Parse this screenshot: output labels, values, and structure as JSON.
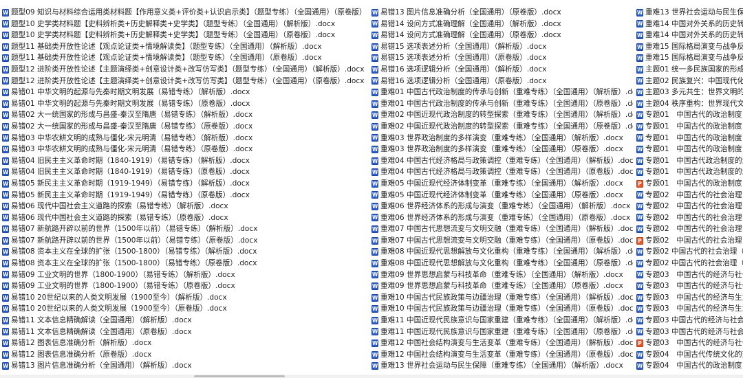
{
  "columns": [
    {
      "files": [
        {
          "icon": "word-doc-icon",
          "name": "题型09 知识与材料综合运用类材料题【作用意义类+评价类+认识启示类】（题型专练）（全国通用）（原卷版）.docx"
        },
        {
          "icon": "word-doc-icon",
          "name": "题型10 史学类材料题【史料辨析类+历史解释类+史学类】（题型专练）（全国通用）（解析版）.docx"
        },
        {
          "icon": "word-doc-icon",
          "name": "题型10 史学类材料题【史料辨析类+历史解释类+史学类】（题型专练）（全国通用）（原卷版）.docx"
        },
        {
          "icon": "word-doc-icon",
          "name": "题型11 基础类开放性论述【观点论证类+情境解读类】（题型专练）（全国通用）（解析版）.docx"
        },
        {
          "icon": "word-doc-icon",
          "name": "题型11 基础类开放性论述【观点论证类+情境解读类】（题型专练）（全国通用）（原卷版）.docx"
        },
        {
          "icon": "word-doc-icon",
          "name": "题型12 进阶类开放性论述【主题演绎类+创意设计类+改写仿写类】（题型专练）（全国通用）（解析版）.docx"
        },
        {
          "icon": "word-doc-icon",
          "name": "题型12 进阶类开放性论述【主题演绎类+创意设计类+改写仿写类】（题型专练）（全国通用）（原卷版）.docx"
        },
        {
          "icon": "word-doc-icon",
          "name": "易错01 中华文明的起源与先秦时期文明发展（易错专练）（解析版）.docx"
        },
        {
          "icon": "word-doc-icon",
          "name": "易错01 中华文明的起源与先秦时期文明发展（易错专练）（原卷版）.docx"
        },
        {
          "icon": "word-doc-icon",
          "name": "易错02 大一统国家的形成与昌盛-秦汉至隋唐（易错专练）（解析版）.docx"
        },
        {
          "icon": "word-doc-icon",
          "name": "易错02 大一统国家的形成与昌盛-秦汉至隋唐（易错专练）（原卷版）.docx"
        },
        {
          "icon": "word-doc-icon",
          "name": "易错03 中华农耕文明的成熟与僵化-宋元明清（易错专练）（解析版）.docx"
        },
        {
          "icon": "word-doc-icon",
          "name": "易错03 中华农耕文明的成熟与僵化-宋元明清（易错专练）（原卷版）.docx"
        },
        {
          "icon": "word-doc-icon",
          "name": "易错04 旧民主主义革命时期（1840-1919）（易错专练）（解析版）.docx"
        },
        {
          "icon": "word-doc-icon",
          "name": "易错04 旧民主主义革命时期（1840-1919）（易错专练）（原卷版）.docx"
        },
        {
          "icon": "word-doc-icon",
          "name": "易错05 新民主主义革命时期（1919-1949）（易错专练）（解析版）.docx"
        },
        {
          "icon": "word-doc-icon",
          "name": "易错05 新民主主义革命时期（1919-1949）（易错专练）（原卷版）.docx"
        },
        {
          "icon": "word-doc-icon",
          "name": "易错06 现代中国社会主义道路的探索（易错专练）（解析版）.docx"
        },
        {
          "icon": "word-doc-icon",
          "name": "易错06 现代中国社会主义道路的探索（易错专练）（原卷版）.docx"
        },
        {
          "icon": "word-doc-icon",
          "name": "易错07 新航路开辟以前的世界（1500年以前）（易错专练）（解析版）.docx"
        },
        {
          "icon": "word-doc-icon",
          "name": "易错07 新航路开辟以前的世界（1500年以前）（易错专练）（原卷版）.docx"
        },
        {
          "icon": "word-doc-icon",
          "name": "易错08 资本主义在全球的扩张（1500-1800）（易错专练）（解析版）.docx"
        },
        {
          "icon": "word-doc-icon",
          "name": "易错08 资本主义在全球的扩张（1500-1800）（易错专练）（原卷版）.docx"
        },
        {
          "icon": "word-doc-icon",
          "name": "易错09 工业文明的世界（1800-1900）（易错专练）（解析版）.docx"
        },
        {
          "icon": "word-doc-icon",
          "name": "易错09 工业文明的世界（1800-1900）（易错专练）（原卷版）.docx"
        },
        {
          "icon": "word-doc-icon",
          "name": "易错10 20世纪以来的人类文明发展（1900至今）（解析版）.docx"
        },
        {
          "icon": "word-doc-icon",
          "name": "易错10 20世纪以来的人类文明发展（1900至今）（原卷版）.docx"
        },
        {
          "icon": "word-doc-icon",
          "name": "易错11 文本信息精确解读（全国通用）（解析版）.docx"
        },
        {
          "icon": "word-doc-icon",
          "name": "易错11 文本信息精确解读（全国通用）（原卷版）.docx"
        },
        {
          "icon": "word-doc-icon",
          "name": "易错12 图表信息准确分析（解析版）.docx"
        },
        {
          "icon": "word-doc-icon",
          "name": "易错12 图表信息准确分析（原卷版）.docx"
        },
        {
          "icon": "word-doc-icon",
          "name": "易错13 图片信息准确分析（全国通用）（解析版）.docx"
        }
      ]
    },
    {
      "files": [
        {
          "icon": "word-doc-icon",
          "name": "易错13 图片信息准确分析（全国通用）（原卷版）.docx"
        },
        {
          "icon": "word-doc-icon",
          "name": "易错14 设问方式准确理解（全国通用）（解析版）.docx"
        },
        {
          "icon": "word-doc-icon",
          "name": "易错14 设问方式准确理解（全国通用）（原卷版）.docx"
        },
        {
          "icon": "word-doc-icon",
          "name": "易错15 选项表述分析（全国通用）（解析版）.docx"
        },
        {
          "icon": "word-doc-icon",
          "name": "易错15 选项表述分析（全国通用）（原卷版）.docx"
        },
        {
          "icon": "word-doc-icon",
          "name": "易错16 选项逻辑分析（全国通用）（解析版）.docx"
        },
        {
          "icon": "word-doc-icon",
          "name": "易错16 选项逻辑分析（全国通用）（原卷版）.docx"
        },
        {
          "icon": "word-doc-icon",
          "name": "重难01 中国古代政治制度的传承与创新（重难专练）（全国通用）（解析版）.docx"
        },
        {
          "icon": "word-doc-icon",
          "name": "重难01 中国古代政治制度的传承与创新（重难专练）（全国通用）（原卷版）.docx"
        },
        {
          "icon": "word-doc-icon",
          "name": "重难02 中国近现代政治制度的转型探索（重难专练）（全国通用）（解析版）.docx"
        },
        {
          "icon": "word-doc-icon",
          "name": "重难02 中国近现代政治制度的转型探索（重难专练）（全国通用）（原卷版）.docx"
        },
        {
          "icon": "word-doc-icon",
          "name": "重难03 世界政治制度的多样演变（重难专练）（全国通用）（解析版）.docx"
        },
        {
          "icon": "word-doc-icon",
          "name": "重难03 世界政治制度的多样演变（重难专练）（全国通用）（原卷版）.docx"
        },
        {
          "icon": "word-doc-icon",
          "name": "重难04 中国古代经济格局与政策调控（重难专练）（全国通用）（解析版）.docx"
        },
        {
          "icon": "word-doc-icon",
          "name": "重难04 中国古代经济格局与政策调控（重难专练）（全国通用）（原卷版）.docx"
        },
        {
          "icon": "word-doc-icon",
          "name": "重难05 中国近现代经济体制变革（重难专练）（全国通用）（解析版）.docx"
        },
        {
          "icon": "word-doc-icon",
          "name": "重难05 中国近现代经济体制变革（重难专练）（全国通用）（原卷版）.docx"
        },
        {
          "icon": "word-doc-icon",
          "name": "重难06 世界经济体系的形成与演变（重难专练）（全国通用）（解析版）.docx"
        },
        {
          "icon": "word-doc-icon",
          "name": "重难06 世界经济体系的形成与演变（重难专练）（全国通用）（原卷版）.docx"
        },
        {
          "icon": "word-doc-icon",
          "name": "重难07 中国古代思想流变与文明交融（重难专练）（全国通用）（解析版）.docx"
        },
        {
          "icon": "word-doc-icon",
          "name": "重难07 中国古代思想流变与文明交融（重难专练）（全国通用）（原卷版）.docx"
        },
        {
          "icon": "word-doc-icon",
          "name": "重难08 中国近现代思想解放与文化重构（重难专练）（全国通用）（解析版）.docx"
        },
        {
          "icon": "word-doc-icon",
          "name": "重难08 中国近现代思想解放与文化重构（重难专练）（全国通用）（原卷版）.docx"
        },
        {
          "icon": "word-doc-icon",
          "name": "重难09 世界思想启蒙与科技革命（重难专练）（全国通用）（解析版）.docx"
        },
        {
          "icon": "word-doc-icon",
          "name": "重难09 世界思想启蒙与科技革命（重难专练）（全国通用）（原卷版）.docx"
        },
        {
          "icon": "word-doc-icon",
          "name": "重难10 中国古代民族政策与边疆治理（重难专练）（全国通用）（解析版）.docx"
        },
        {
          "icon": "word-doc-icon",
          "name": "重难10 中国古代民族政策与边疆治理（重难专练）（全国通用）（原卷版）.docx"
        },
        {
          "icon": "word-doc-icon",
          "name": "重难11 中国近现代民族意识与国家重建（重难专练）（全国通用）（解析版）.docx"
        },
        {
          "icon": "word-doc-icon",
          "name": "重难11 中国近现代民族意识与国家重建（重难专练）（全国通用）（原卷版）.docx"
        },
        {
          "icon": "word-doc-icon",
          "name": "重难12 中国社会结构演变与生活变革（重难专练）（全国通用）（解析版）.docx"
        },
        {
          "icon": "word-doc-icon",
          "name": "重难12 中国社会结构演变与生活变革（重难专练）（全国通用）（原卷版）.docx"
        },
        {
          "icon": "word-doc-icon",
          "name": "重难13 世界社会运动与民生保障（重难专练）（全国通用）（解析版）.docx"
        }
      ]
    },
    {
      "files": [
        {
          "icon": "word-doc-icon",
          "name": "重难13 世界社会运动与民生保障"
        },
        {
          "icon": "word-doc-icon",
          "name": "重难14 中国对外关系的历史转型"
        },
        {
          "icon": "word-doc-icon",
          "name": "重难14 中国对外关系的历史转型"
        },
        {
          "icon": "word-doc-icon",
          "name": "重难15 国际格局演变与战争反思"
        },
        {
          "icon": "word-doc-icon",
          "name": "重难15 国际格局演变与战争反思"
        },
        {
          "icon": "word-doc-icon",
          "name": "主题01 统一多民族国家的形成与发"
        },
        {
          "icon": "word-doc-icon",
          "name": "主题02 民族复兴：中国现代化的探"
        },
        {
          "icon": "word-doc-icon",
          "name": "主题03 多元共生：世界文明的演进"
        },
        {
          "icon": "word-doc-icon",
          "name": "主题04 秩序重构：世界现代文明的"
        },
        {
          "icon": "word-doc-icon",
          "name": "专题01　中国古代的政治制度（复"
        },
        {
          "icon": "word-doc-icon",
          "name": "专题01　中国古代的政治制度（复"
        },
        {
          "icon": "word-doc-icon",
          "name": "专题01　中国古代的政治制度（专"
        },
        {
          "icon": "word-doc-icon",
          "name": "专题01　中国古代的政治制度（专"
        },
        {
          "icon": "word-doc-icon",
          "name": "专题01　中国古代政治制度的演进"
        },
        {
          "icon": "word-doc-icon",
          "name": "专题01　中国古代政治制度的演进"
        },
        {
          "icon": "ppt-doc-icon",
          "name": "专题01　中国古代的政治制度（复"
        },
        {
          "icon": "word-doc-icon",
          "name": "专题02　中国古代的社会治理（复"
        },
        {
          "icon": "word-doc-icon",
          "name": "专题02　中国古代的社会治理（复"
        },
        {
          "icon": "word-doc-icon",
          "name": "专题02　中国古代的社会治理（史"
        },
        {
          "icon": "word-doc-icon",
          "name": "专题02　中国古代的社会治理（史"
        },
        {
          "icon": "ppt-doc-icon",
          "name": "专题02　中国古代的社会治理（复"
        },
        {
          "icon": "word-doc-icon",
          "name": "专题02 中国古代的社会治理（专题"
        },
        {
          "icon": "word-doc-icon",
          "name": "专题02 中国古代的社会治理（专题"
        },
        {
          "icon": "word-doc-icon",
          "name": "专题03　中国古代的经济与社会生"
        },
        {
          "icon": "word-doc-icon",
          "name": "专题03　中国古代的经济与社会生"
        },
        {
          "icon": "word-doc-icon",
          "name": "专题03　中国古代的经济与生活（"
        },
        {
          "icon": "word-doc-icon",
          "name": "专题03　中国古代的经济与生活（"
        },
        {
          "icon": "word-doc-icon",
          "name": "专题03 中国古代的经济与社会生活"
        },
        {
          "icon": "word-doc-icon",
          "name": "专题03 中国古代的经济与社会生活"
        },
        {
          "icon": "ppt-doc-icon",
          "name": "专题03　中国古代的经济与社会生"
        },
        {
          "icon": "word-doc-icon",
          "name": "专题04　中国古代传统文化的交流"
        },
        {
          "icon": "word-doc-icon",
          "name": "专题04　中国古代的政治制度（复"
        }
      ]
    }
  ]
}
